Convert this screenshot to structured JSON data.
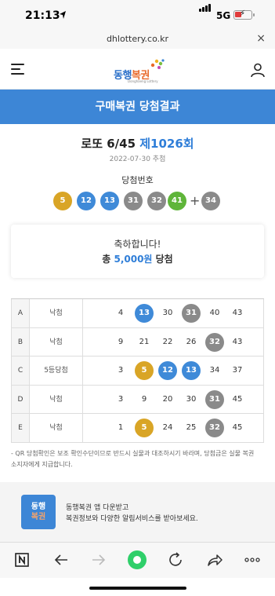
{
  "status_bar": {
    "time": "21:13",
    "network": "5G",
    "battery_level": 0.2
  },
  "browser": {
    "url": "dhlottery.co.kr",
    "close_glyph": "×"
  },
  "header": {
    "menu_icon": "hamburger-icon",
    "logo_text_a": "동행",
    "logo_text_b": "복권",
    "logo_sub": "Donghaeng Lottery",
    "user_icon": "user-icon"
  },
  "banner": {
    "title": "구매복권 당첨결과"
  },
  "draw": {
    "game": "로또 6/45",
    "round": "제1026회",
    "date": "2022-07-30 추첨",
    "winning_label": "당첨번호",
    "numbers": [
      "5",
      "12",
      "13",
      "31",
      "32",
      "41"
    ],
    "plus": "+",
    "bonus": "34"
  },
  "prize": {
    "congrats": "축하합니다!",
    "prefix": "총 ",
    "amount": "5,000원",
    "suffix": " 당첨"
  },
  "tickets": [
    {
      "label": "A",
      "result": "낙첨",
      "numbers": [
        "4",
        "13",
        "30",
        "31",
        "40",
        "43"
      ]
    },
    {
      "label": "B",
      "result": "낙첨",
      "numbers": [
        "9",
        "21",
        "22",
        "26",
        "32",
        "43"
      ]
    },
    {
      "label": "C",
      "result": "5등당첨",
      "numbers": [
        "3",
        "5",
        "12",
        "13",
        "34",
        "37"
      ]
    },
    {
      "label": "D",
      "result": "낙첨",
      "numbers": [
        "3",
        "9",
        "20",
        "30",
        "31",
        "45"
      ]
    },
    {
      "label": "E",
      "result": "낙첨",
      "numbers": [
        "1",
        "5",
        "24",
        "25",
        "32",
        "45"
      ]
    }
  ],
  "notice": {
    "line1": "- QR 당첨확인은 보조 확인수단이므로 반드시 실물과 대조하시기 바라며, 당첨금은 실물 복권",
    "line2": "소지자에게 지급합니다."
  },
  "app_promo": {
    "logo_a": "동행",
    "logo_b": "복권",
    "line1": "동행복권 앱 다운받고",
    "line2": "복권정보와 다양한 알림서비스를 받아보세요."
  },
  "toolbar": {
    "icons": [
      "naver-icon",
      "back-arrow-icon",
      "forward-arrow-icon",
      "home-green-icon",
      "reload-icon",
      "share-icon",
      "more-icon"
    ]
  },
  "colors": {
    "banner": "#3d86d6",
    "ball_yellow": "#d9a526",
    "ball_blue": "#3f8ad8",
    "ball_gray": "#8a8a8a",
    "ball_green": "#5fb53a",
    "accent": "#2f7ed8"
  }
}
